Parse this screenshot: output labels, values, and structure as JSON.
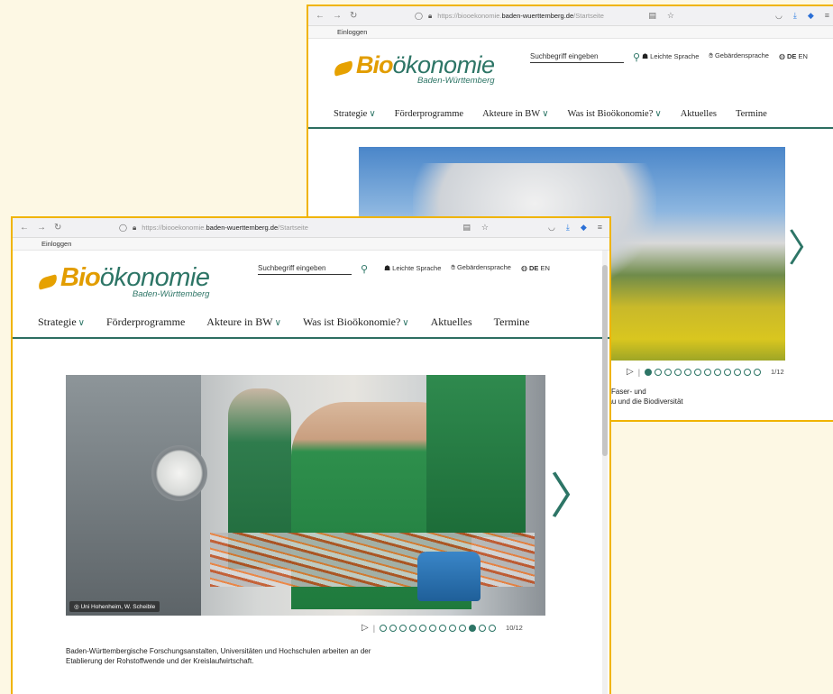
{
  "browser": {
    "url_prefix": "https://biooekonomie.",
    "url_domain": "baden-wuerttemberg.de",
    "url_path": "/Startseite"
  },
  "bookmarks": {
    "login": "Einloggen"
  },
  "logo": {
    "bio": "Bio",
    "oek": "ökonomie",
    "sub": "Baden-Württemberg"
  },
  "search": {
    "placeholder": "Suchbegriff eingeben"
  },
  "tools": {
    "easy_lang": "Leichte Sprache",
    "sign_lang": "Gebärdensprache",
    "lang_de": "DE",
    "lang_en": "EN"
  },
  "nav": [
    {
      "label": "Strategie"
    },
    {
      "label": "Förderprogramme"
    },
    {
      "label": "Akteure in BW"
    },
    {
      "label": "Was ist Bioökonomie?"
    },
    {
      "label": "Aktuelles"
    },
    {
      "label": "Termine"
    }
  ],
  "front_slide": {
    "credit": "Uni Hohenheim, W. Scheible",
    "counter": "10/12",
    "active_index": 10,
    "total": 12,
    "description_line1": "Baden-Württembergische Forschungsanstalten, Universitäten und Hochschulen arbeiten an der",
    "description_line2": "Etablierung der Rohstoffwende und der Kreislaufwirtschaft."
  },
  "back_slide": {
    "counter": "1/12",
    "active_index": 1,
    "total": 12,
    "description_line1": "ls Faser- und",
    "description_line2": "bau und die Biodiversität"
  }
}
